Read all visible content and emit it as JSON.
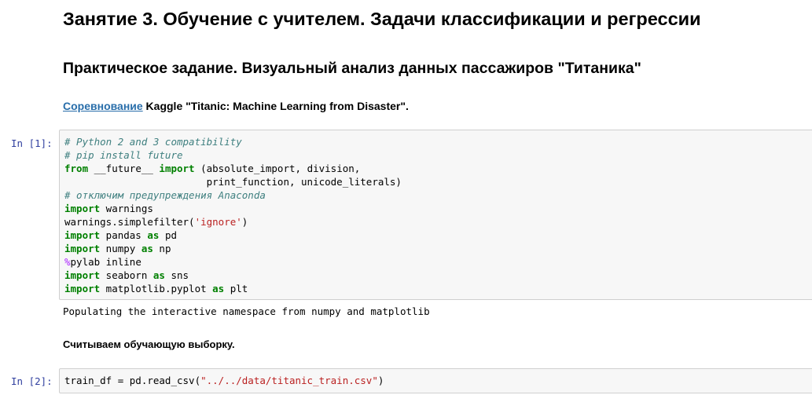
{
  "header": {
    "title": "Занятие 3. Обучение с учителем. Задачи классификации и регрессии",
    "subtitle": "Практическое задание. Визуальный анализ данных пассажиров \"Титаника\""
  },
  "intro": {
    "link_text": "Соревнование",
    "text": " Kaggle \"Titanic: Machine Learning from Disaster\"."
  },
  "cells": [
    {
      "prompt": "In [1]:",
      "lines": [
        [
          {
            "t": "cm",
            "v": "# Python 2 and 3 compatibility"
          }
        ],
        [
          {
            "t": "cm",
            "v": "# pip install future"
          }
        ],
        [
          {
            "t": "kw",
            "v": "from"
          },
          {
            "t": "n",
            "v": " __future__ "
          },
          {
            "t": "kw",
            "v": "import"
          },
          {
            "t": "n",
            "v": " (absolute_import, division,"
          }
        ],
        [
          {
            "t": "n",
            "v": "                        print_function, unicode_literals)"
          }
        ],
        [
          {
            "t": "cm",
            "v": "# отключим предупреждения Anaconda"
          }
        ],
        [
          {
            "t": "kw",
            "v": "import"
          },
          {
            "t": "n",
            "v": " warnings"
          }
        ],
        [
          {
            "t": "n",
            "v": "warnings.simplefilter("
          },
          {
            "t": "st",
            "v": "'ignore'"
          },
          {
            "t": "n",
            "v": ")"
          }
        ],
        [
          {
            "t": "kw",
            "v": "import"
          },
          {
            "t": "n",
            "v": " pandas "
          },
          {
            "t": "kw",
            "v": "as"
          },
          {
            "t": "n",
            "v": " pd"
          }
        ],
        [
          {
            "t": "kw",
            "v": "import"
          },
          {
            "t": "n",
            "v": " numpy "
          },
          {
            "t": "kw",
            "v": "as"
          },
          {
            "t": "n",
            "v": " np"
          }
        ],
        [
          {
            "t": "mg",
            "v": "%"
          },
          {
            "t": "n",
            "v": "pylab inline"
          }
        ],
        [
          {
            "t": "kw",
            "v": "import"
          },
          {
            "t": "n",
            "v": " seaborn "
          },
          {
            "t": "kw",
            "v": "as"
          },
          {
            "t": "n",
            "v": " sns"
          }
        ],
        [
          {
            "t": "kw",
            "v": "import"
          },
          {
            "t": "n",
            "v": " matplotlib.pyplot "
          },
          {
            "t": "kw",
            "v": "as"
          },
          {
            "t": "n",
            "v": " plt"
          }
        ]
      ],
      "output": "Populating the interactive namespace from numpy and matplotlib"
    },
    {
      "prompt": "In [2]:",
      "lines": [
        [
          {
            "t": "n",
            "v": "train_df = pd.read_csv("
          },
          {
            "t": "st",
            "v": "\"../../data/titanic_train.csv\""
          },
          {
            "t": "n",
            "v": ")"
          }
        ]
      ]
    }
  ],
  "markdown": {
    "subheading": "Считываем обучающую выборку."
  },
  "colors": {
    "comment": "#408080",
    "keyword": "#008000",
    "string": "#ba2121",
    "magic": "#aa22ff",
    "prompt": "#303f9f",
    "link": "#296eaa",
    "cell_bg": "#f7f7f7",
    "cell_border": "#cfcfcf"
  }
}
